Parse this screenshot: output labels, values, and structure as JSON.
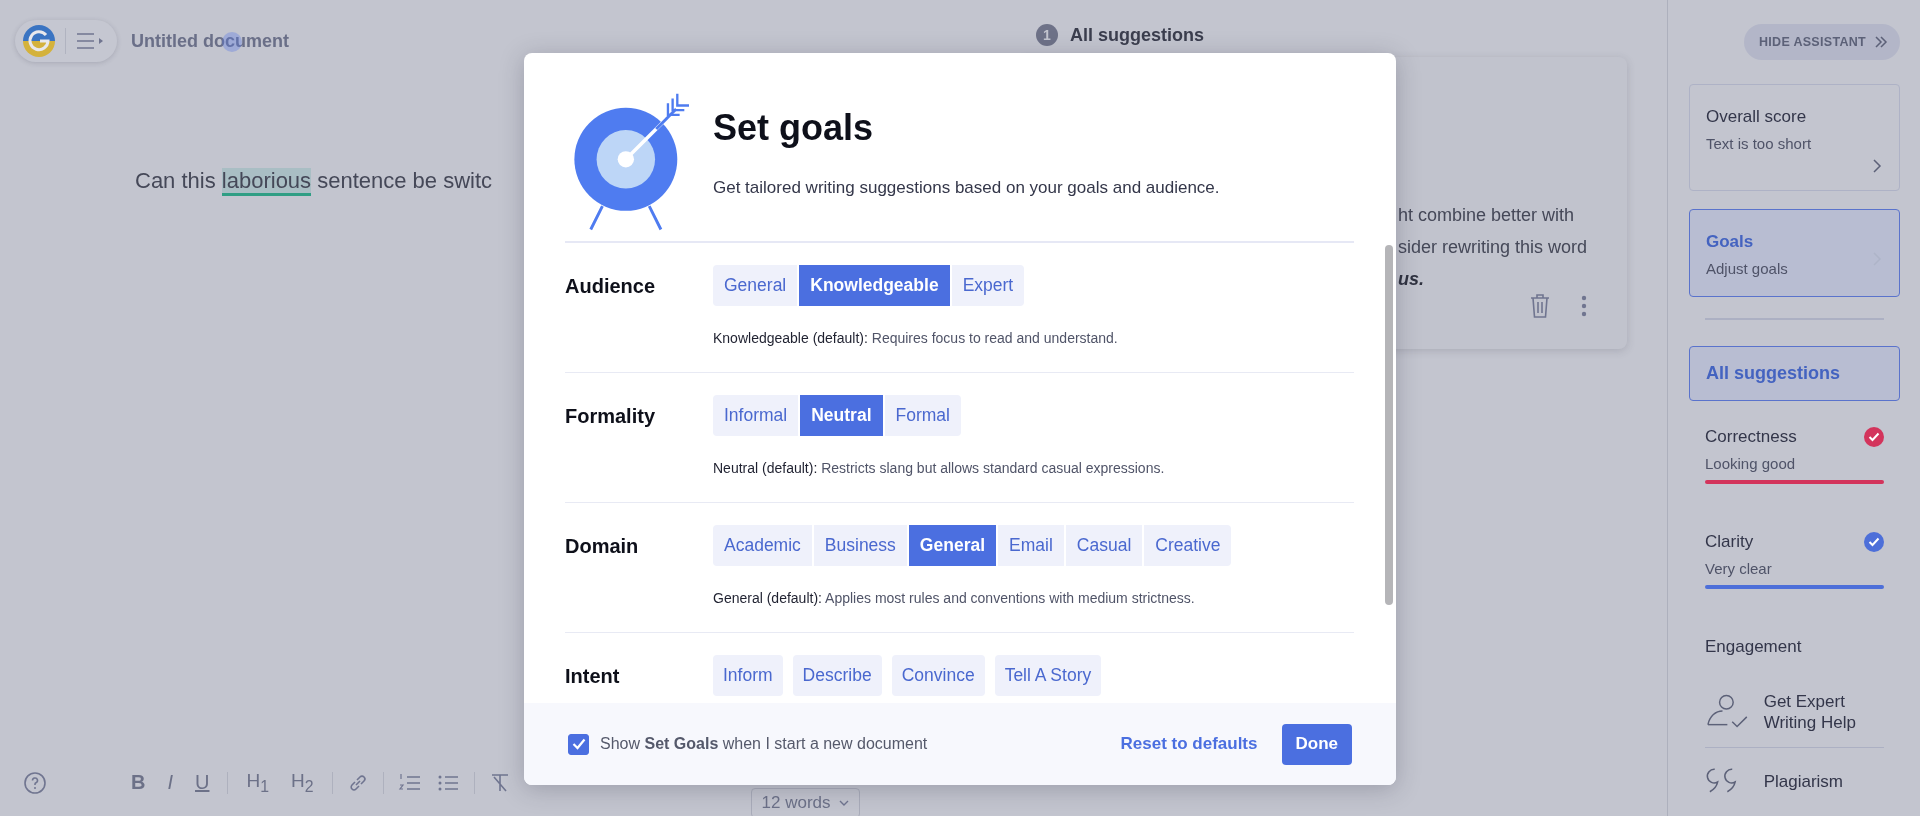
{
  "editor": {
    "title": "Untitled document",
    "text_before": "Can this ",
    "highlighted_word": "laborious",
    "text_after": " sentence be switc",
    "word_count": "12 words"
  },
  "toolbar": [
    {
      "kind": "bold",
      "label": "B"
    },
    {
      "kind": "italic",
      "label": "I"
    },
    {
      "kind": "underline",
      "label": "U"
    },
    {
      "kind": "heading",
      "label": "H$_{1}$"
    },
    {
      "kind": "heading",
      "label": "H$_{2}$"
    }
  ],
  "suggestions_header": {
    "count": "1",
    "title": "All suggestions"
  },
  "suggestion_card": {
    "lines": [
      {
        "text": "ht combine better with",
        "emphasis": false
      },
      {
        "text": "sider rewriting this word",
        "emphasis": false
      },
      {
        "text": "us.",
        "emphasis": true
      }
    ]
  },
  "assistant": {
    "hide_button": "HIDE ASSISTANT",
    "cards": [
      {
        "title": "Overall score",
        "subtitle": "Text is too short",
        "selected": false
      },
      {
        "title": "Goals",
        "subtitle": "Adjust goals",
        "selected": true
      }
    ],
    "all_suggestions": {
      "label": "All suggestions",
      "selected": true
    },
    "categories": [
      {
        "name": "Correctness",
        "status": "Looking good",
        "color": "#d3345c"
      },
      {
        "name": "Clarity",
        "status": "Very clear",
        "color": "#4d6fd9"
      },
      {
        "name": "Engagement"
      }
    ],
    "links": [
      {
        "kind": "expert",
        "label": "Get Expert Writing Help"
      },
      {
        "kind": "plagiarism",
        "label": "Plagiarism"
      }
    ]
  },
  "modal": {
    "title": "Set goals",
    "subtitle": "Get tailored writing suggestions based on your goals and audience.",
    "sections": [
      {
        "label": "Audience",
        "kind": "segmented",
        "options": [
          {
            "label": "General",
            "selected": false
          },
          {
            "label": "Knowledgeable",
            "selected": true
          },
          {
            "label": "Expert",
            "selected": false
          }
        ],
        "description_label": "Knowledgeable (default):",
        "description": "Requires focus to read and understand."
      },
      {
        "label": "Formality",
        "kind": "segmented",
        "options": [
          {
            "label": "Informal",
            "selected": false
          },
          {
            "label": "Neutral",
            "selected": true
          },
          {
            "label": "Formal",
            "selected": false
          }
        ],
        "description_label": "Neutral (default):",
        "description": "Restricts slang but allows standard casual expressions."
      },
      {
        "label": "Domain",
        "kind": "segmented",
        "options": [
          {
            "label": "Academic",
            "selected": false
          },
          {
            "label": "Business",
            "selected": false
          },
          {
            "label": "General",
            "selected": true
          },
          {
            "label": "Email",
            "selected": false
          },
          {
            "label": "Casual",
            "selected": false
          },
          {
            "label": "Creative",
            "selected": false
          }
        ],
        "description_label": "General (default):",
        "description": "Applies most rules and conventions with medium strictness."
      },
      {
        "label": "Intent",
        "kind": "separate",
        "options": [
          {
            "label": "Inform",
            "selected": false
          },
          {
            "label": "Describe",
            "selected": false
          },
          {
            "label": "Convince",
            "selected": false
          },
          {
            "label": "Tell A Story",
            "selected": false
          }
        ]
      }
    ],
    "show_on_new": {
      "checked": true,
      "text": "Show **Set Goals** when I start a new document"
    },
    "reset": "Reset to defaults",
    "done": "Done"
  }
}
